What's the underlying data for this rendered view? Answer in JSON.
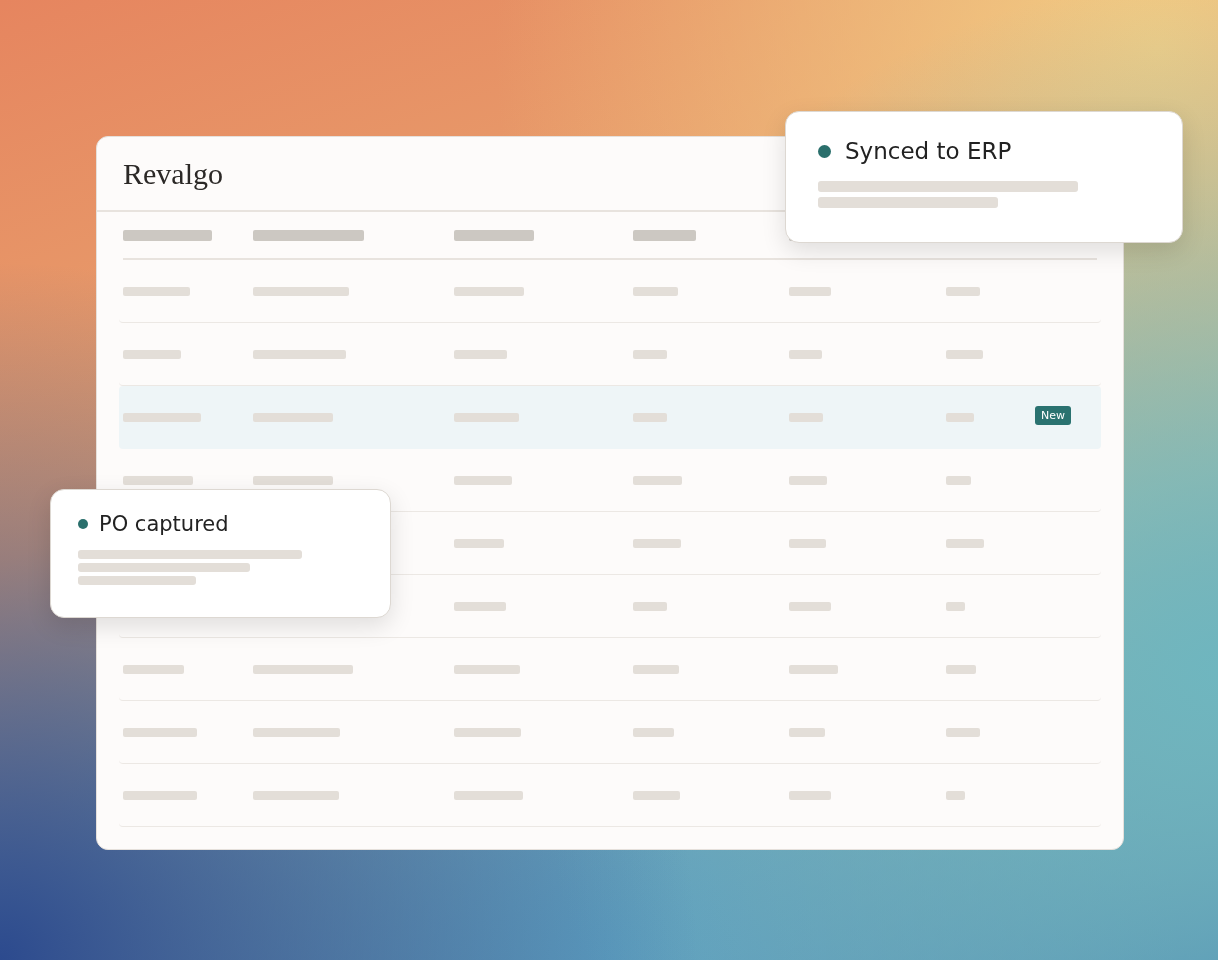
{
  "window": {
    "title": "Revalgo"
  },
  "table": {
    "rows": [
      {
        "selected": false
      },
      {
        "selected": false
      },
      {
        "selected": true,
        "badge": "New"
      },
      {
        "selected": false
      },
      {
        "selected": false
      },
      {
        "selected": false
      },
      {
        "selected": false
      },
      {
        "selected": false
      },
      {
        "selected": false
      }
    ]
  },
  "notifications": [
    {
      "title": "Synced to ERP",
      "color": "#2a6f6c"
    },
    {
      "title": "PO captured",
      "color": "#2a6f6c"
    }
  ]
}
